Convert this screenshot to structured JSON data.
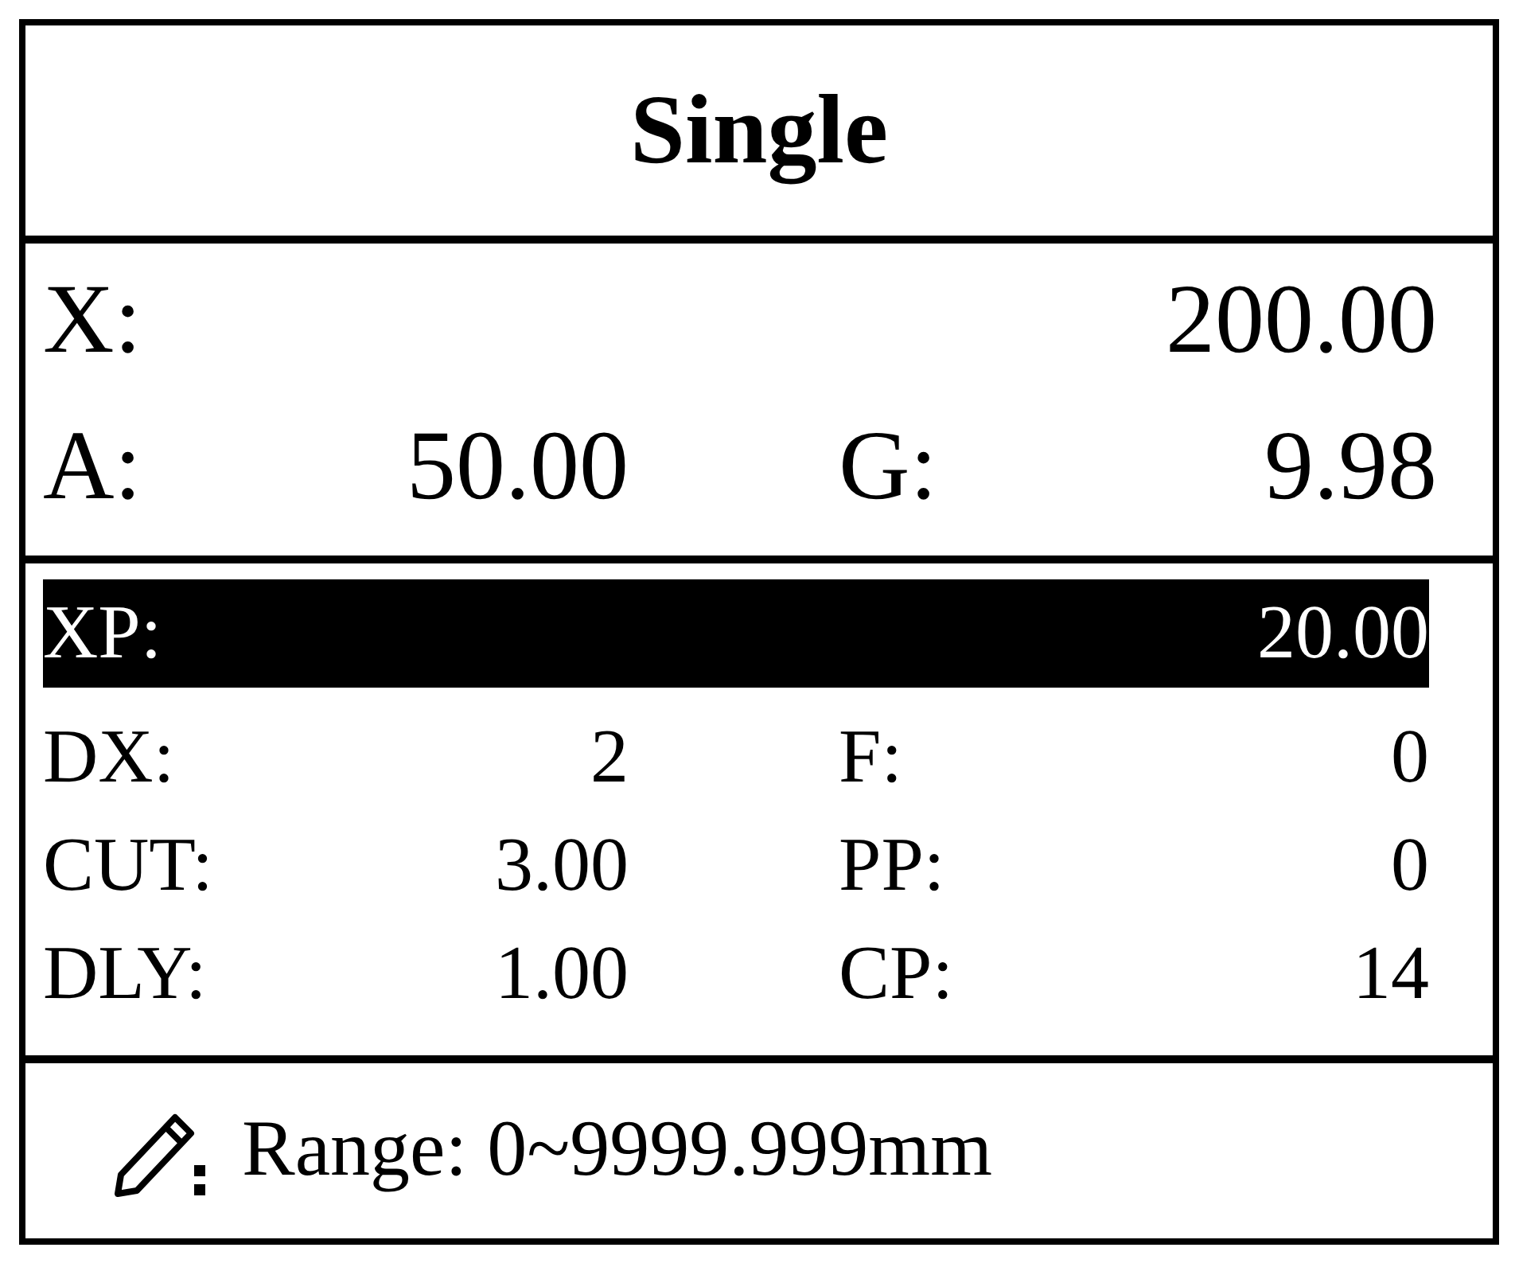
{
  "title": "Single",
  "readouts": [
    {
      "kind": "wide",
      "label": "X:",
      "value": "200.00"
    },
    {
      "kind": "pair",
      "label": "A:",
      "value": "50.00",
      "label_2": "G:",
      "value_2": "9.98"
    }
  ],
  "parameters": [
    {
      "kind": "wide",
      "label": "XP:",
      "value": "20.00",
      "selected": true
    },
    {
      "kind": "pair",
      "label": "DX:",
      "value": "2",
      "label_2": "F:",
      "value_2": "0",
      "selected": false
    },
    {
      "kind": "pair",
      "label": "CUT:",
      "value": "3.00",
      "label_2": "PP:",
      "value_2": "0",
      "selected": false
    },
    {
      "kind": "pair",
      "label": "DLY:",
      "value": "1.00",
      "label_2": "CP:",
      "value_2": "14",
      "selected": false
    }
  ],
  "hint": {
    "text": "Range: 0~9999.999mm"
  }
}
